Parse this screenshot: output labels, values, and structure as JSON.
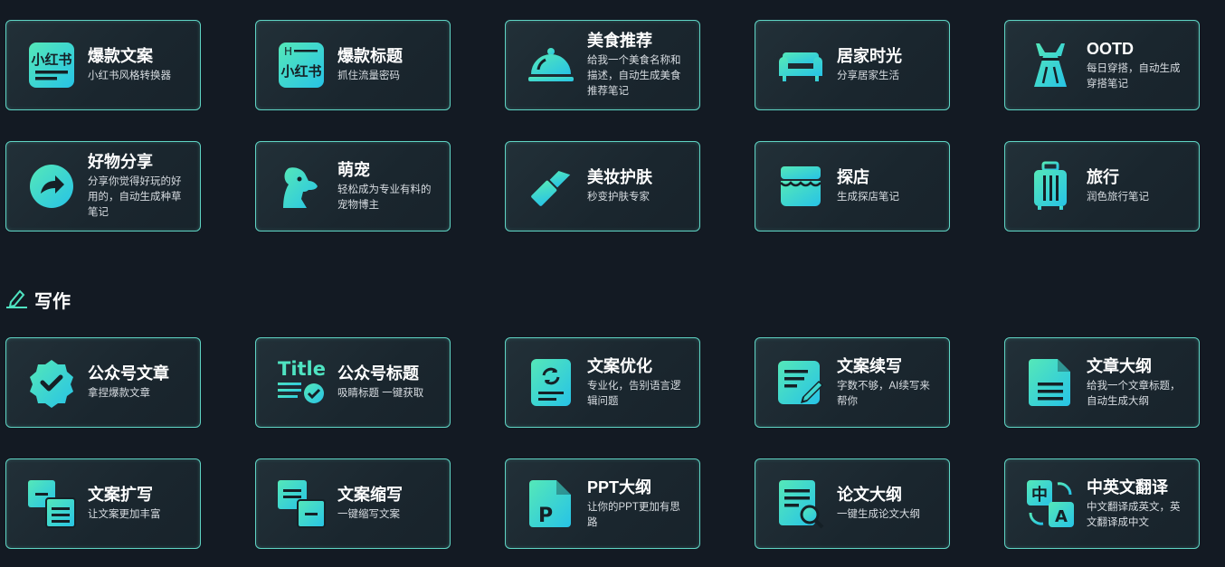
{
  "colors": {
    "accent_start": "#4fe3c1",
    "accent_end": "#2ac4e0",
    "card_border": "#5fd4c4",
    "background": "#131a23"
  },
  "section_writing": {
    "icon": "pencil-icon",
    "label": "写作"
  },
  "row1": [
    {
      "icon": "xiaohongshu-icon",
      "title": "爆款文案",
      "desc": "小红书风格转换器"
    },
    {
      "icon": "xiaohongshu-title-icon",
      "title": "爆款标题",
      "desc": "抓住流量密码"
    },
    {
      "icon": "cloche-icon",
      "title": "美食推荐",
      "desc": "给我一个美食名称和描述，自动生成美食推荐笔记"
    },
    {
      "icon": "sofa-icon",
      "title": "居家时光",
      "desc": "分享居家生活"
    },
    {
      "icon": "dress-icon",
      "title": "OOTD",
      "desc": "每日穿搭，自动生成穿搭笔记"
    }
  ],
  "row2": [
    {
      "icon": "share-arrow-icon",
      "title": "好物分享",
      "desc": "分享你觉得好玩的好用的，自动生成种草笔记"
    },
    {
      "icon": "dog-icon",
      "title": "萌宠",
      "desc": "轻松成为专业有料的宠物博主"
    },
    {
      "icon": "lipstick-icon",
      "title": "美妆护肤",
      "desc": "秒变护肤专家"
    },
    {
      "icon": "storefront-icon",
      "title": "探店",
      "desc": "生成探店笔记"
    },
    {
      "icon": "luggage-icon",
      "title": "旅行",
      "desc": "润色旅行笔记"
    }
  ],
  "row3": [
    {
      "icon": "verified-badge-icon",
      "title": "公众号文章",
      "desc": "拿捏爆款文章"
    },
    {
      "icon": "title-check-icon",
      "title": "公众号标题",
      "desc": "吸睛标题 一键获取",
      "icon_text": "Title"
    },
    {
      "icon": "document-refresh-icon",
      "title": "文案优化",
      "desc": "专业化，告别语言逻辑问题"
    },
    {
      "icon": "edit-note-icon",
      "title": "文案续写",
      "desc": "字数不够，AI续写来帮你"
    },
    {
      "icon": "document-icon",
      "title": "文章大纲",
      "desc": "给我一个文章标题，自动生成大纲"
    }
  ],
  "row4": [
    {
      "icon": "expand-icon",
      "title": "文案扩写",
      "desc": "让文案更加丰富"
    },
    {
      "icon": "shrink-icon",
      "title": "文案缩写",
      "desc": "一键缩写文案"
    },
    {
      "icon": "ppt-file-icon",
      "title": "PPT大纲",
      "desc": "让你的PPT更加有思路",
      "icon_text": "P"
    },
    {
      "icon": "document-search-icon",
      "title": "论文大纲",
      "desc": "一键生成论文大纲"
    },
    {
      "icon": "translate-icon",
      "title": "中英文翻译",
      "desc": "中文翻译成英文，英文翻译成中文",
      "icon_text_a": "中",
      "icon_text_b": "A"
    }
  ]
}
